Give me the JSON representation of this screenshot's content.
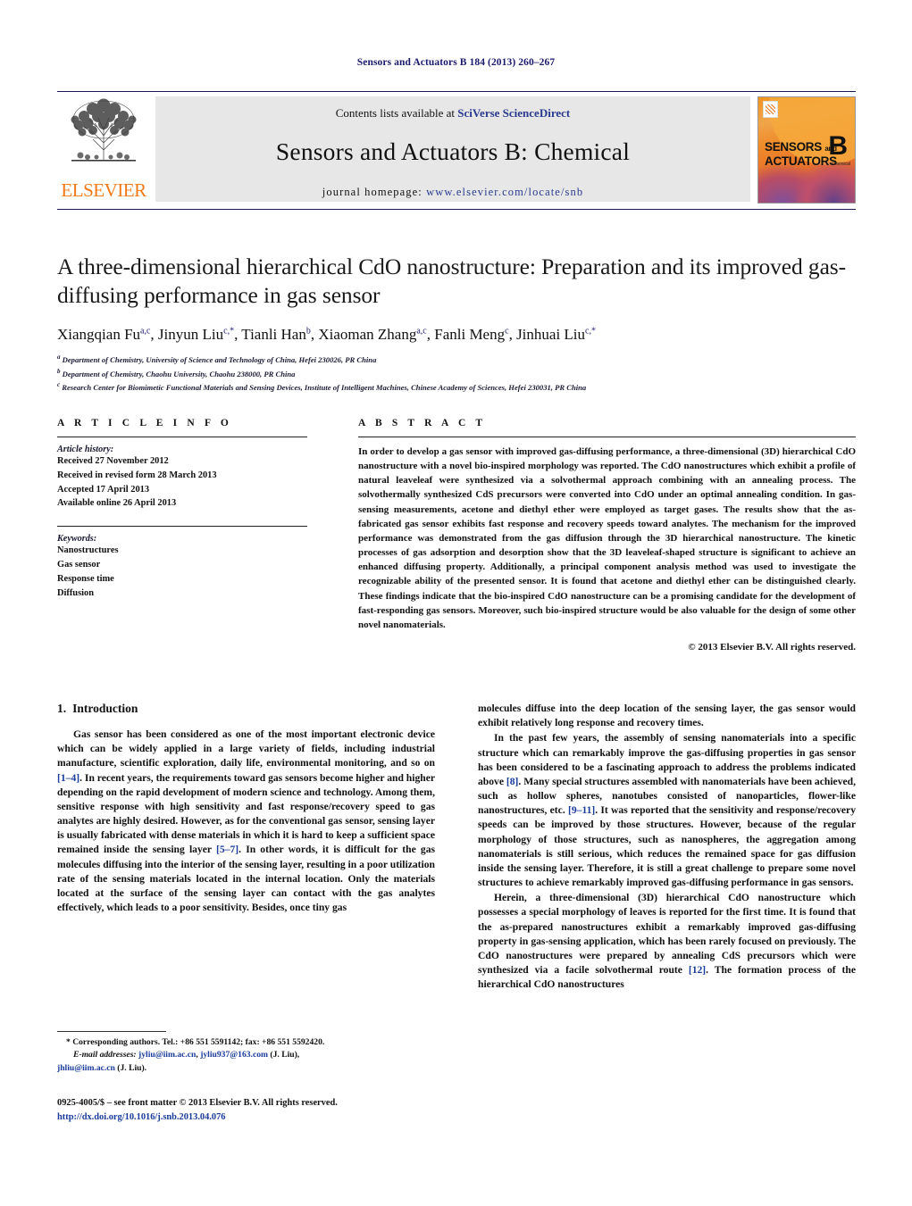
{
  "running_head": "Sensors and Actuators B 184 (2013) 260–267",
  "masthead": {
    "publisher_name": "ELSEVIER",
    "contents_prefix": "Contents lists available at ",
    "contents_link": "SciVerse ScienceDirect",
    "journal_title": "Sensors and Actuators B: Chemical",
    "homepage_prefix": "journal homepage:",
    "homepage_url": "www.elsevier.com/locate/snb",
    "cover": {
      "line1": "SENSORS",
      "and": "and",
      "line2": "ACTUATORS",
      "letter": "B",
      "sublabel": "Chemical"
    }
  },
  "article": {
    "title": "A three-dimensional hierarchical CdO nanostructure: Preparation and its improved gas-diffusing performance in gas sensor",
    "authors": [
      {
        "name": "Xiangqian Fu",
        "sup": "a,c",
        "star": false
      },
      {
        "name": "Jinyun Liu",
        "sup": "c,",
        "star": true
      },
      {
        "name": "Tianli Han",
        "sup": "b",
        "star": false
      },
      {
        "name": "Xiaoman Zhang",
        "sup": "a,c",
        "star": false
      },
      {
        "name": "Fanli Meng",
        "sup": "c",
        "star": false
      },
      {
        "name": "Jinhuai Liu",
        "sup": "c,",
        "star": true
      }
    ],
    "affiliations": [
      {
        "label": "a",
        "text": "Department of Chemistry, University of Science and Technology of China, Hefei 230026, PR China"
      },
      {
        "label": "b",
        "text": "Department of Chemistry, Chaohu University, Chaohu 238000, PR China"
      },
      {
        "label": "c",
        "text": "Research Center for Biomimetic Functional Materials and Sensing Devices, Institute of Intelligent Machines, Chinese Academy of Sciences, Hefei 230031, PR China"
      }
    ]
  },
  "article_info": {
    "heading": "A R T I C L E    I N F O",
    "history_label": "Article history:",
    "history": [
      "Received 27 November 2012",
      "Received in revised form 28 March 2013",
      "Accepted 17 April 2013",
      "Available online 26 April 2013"
    ],
    "keywords_label": "Keywords:",
    "keywords": [
      "Nanostructures",
      "Gas sensor",
      "Response time",
      "Diffusion"
    ]
  },
  "abstract": {
    "heading": "A B S T R A C T",
    "text": "In order to develop a gas sensor with improved gas-diffusing performance, a three-dimensional (3D) hierarchical CdO nanostructure with a novel bio-inspired morphology was reported. The CdO nanostructures which exhibit a profile of natural leaveleaf were synthesized via a solvothermal approach combining with an annealing process. The solvothermally synthesized CdS precursors were converted into CdO under an optimal annealing condition. In gas-sensing measurements, acetone and diethyl ether were employed as target gases. The results show that the as-fabricated gas sensor exhibits fast response and recovery speeds toward analytes. The mechanism for the improved performance was demonstrated from the gas diffusion through the 3D hierarchical nanostructure. The kinetic processes of gas adsorption and desorption show that the 3D leaveleaf-shaped structure is significant to achieve an enhanced diffusing property. Additionally, a principal component analysis method was used to investigate the recognizable ability of the presented sensor. It is found that acetone and diethyl ether can be distinguished clearly. These findings indicate that the bio-inspired CdO nanostructure can be a promising candidate for the development of fast-responding gas sensors. Moreover, such bio-inspired structure would be also valuable for the design of some other novel nanomaterials.",
    "copyright": "© 2013 Elsevier B.V. All rights reserved."
  },
  "introduction": {
    "number": "1.",
    "heading": "Introduction",
    "left_paragraphs": [
      "Gas sensor has been considered as one of the most important electronic device which can be widely applied in a large variety of fields, including industrial manufacture, scientific exploration, daily life, environmental monitoring, and so on [1–4]. In recent years, the requirements toward gas sensors become higher and higher depending on the rapid development of modern science and technology. Among them, sensitive response with high sensitivity and fast response/recovery speed to gas analytes are highly desired. However, as for the conventional gas sensor, sensing layer is usually fabricated with dense materials in which it is hard to keep a sufficient space remained inside the sensing layer [5–7]. In other words, it is difficult for the gas molecules diffusing into the interior of the sensing layer, resulting in a poor utilization rate of the sensing materials located in the internal location. Only the materials located at the surface of the sensing layer can contact with the gas analytes effectively, which leads to a poor sensitivity. Besides, once tiny gas"
    ],
    "right_paragraphs": [
      "molecules diffuse into the deep location of the sensing layer, the gas sensor would exhibit relatively long response and recovery times.",
      "In the past few years, the assembly of sensing nanomaterials into a specific structure which can remarkably improve the gas-diffusing properties in gas sensor has been considered to be a fascinating approach to address the problems indicated above [8]. Many special structures assembled with nanomaterials have been achieved, such as hollow spheres, nanotubes consisted of nanoparticles, flower-like nanostructures, etc. [9–11]. It was reported that the sensitivity and response/recovery speeds can be improved by those structures. However, because of the regular morphology of those structures, such as nanospheres, the aggregation among nanomaterials is still serious, which reduces the remained space for gas diffusion inside the sensing layer. Therefore, it is still a great challenge to prepare some novel structures to achieve remarkably improved gas-diffusing performance in gas sensors.",
      "Herein, a three-dimensional (3D) hierarchical CdO nanostructure which possesses a special morphology of leaves is reported for the first time. It is found that the as-prepared nanostructures exhibit a remarkably improved gas-diffusing property in gas-sensing application, which has been rarely focused on previously. The CdO nanostructures were prepared by annealing CdS precursors which were synthesized via a facile solvothermal route [12]. The formation process of the hierarchical CdO nanostructures"
    ]
  },
  "footnote": {
    "corresponding": "* Corresponding authors. Tel.: +86 551 5591142; fax: +86 551 5592420.",
    "email_label": "E-mail addresses:",
    "email1": "jyliu@iim.ac.cn",
    "email2": "jyliu937@163.com",
    "email1_attr": "(J. Liu),",
    "email3": "jhliu@iim.ac.cn",
    "email3_attr": "(J. Liu)."
  },
  "colophon": {
    "issn_line": "0925-4005/$ – see front matter © 2013 Elsevier B.V. All rights reserved.",
    "doi": "http://dx.doi.org/10.1016/j.snb.2013.04.076"
  },
  "colors": {
    "link_blue": "#1a3c9c",
    "running_head_blue": "#1a1a6e",
    "elsevier_orange": "#f07a1a",
    "masthead_grey": "#e7e7e7"
  }
}
